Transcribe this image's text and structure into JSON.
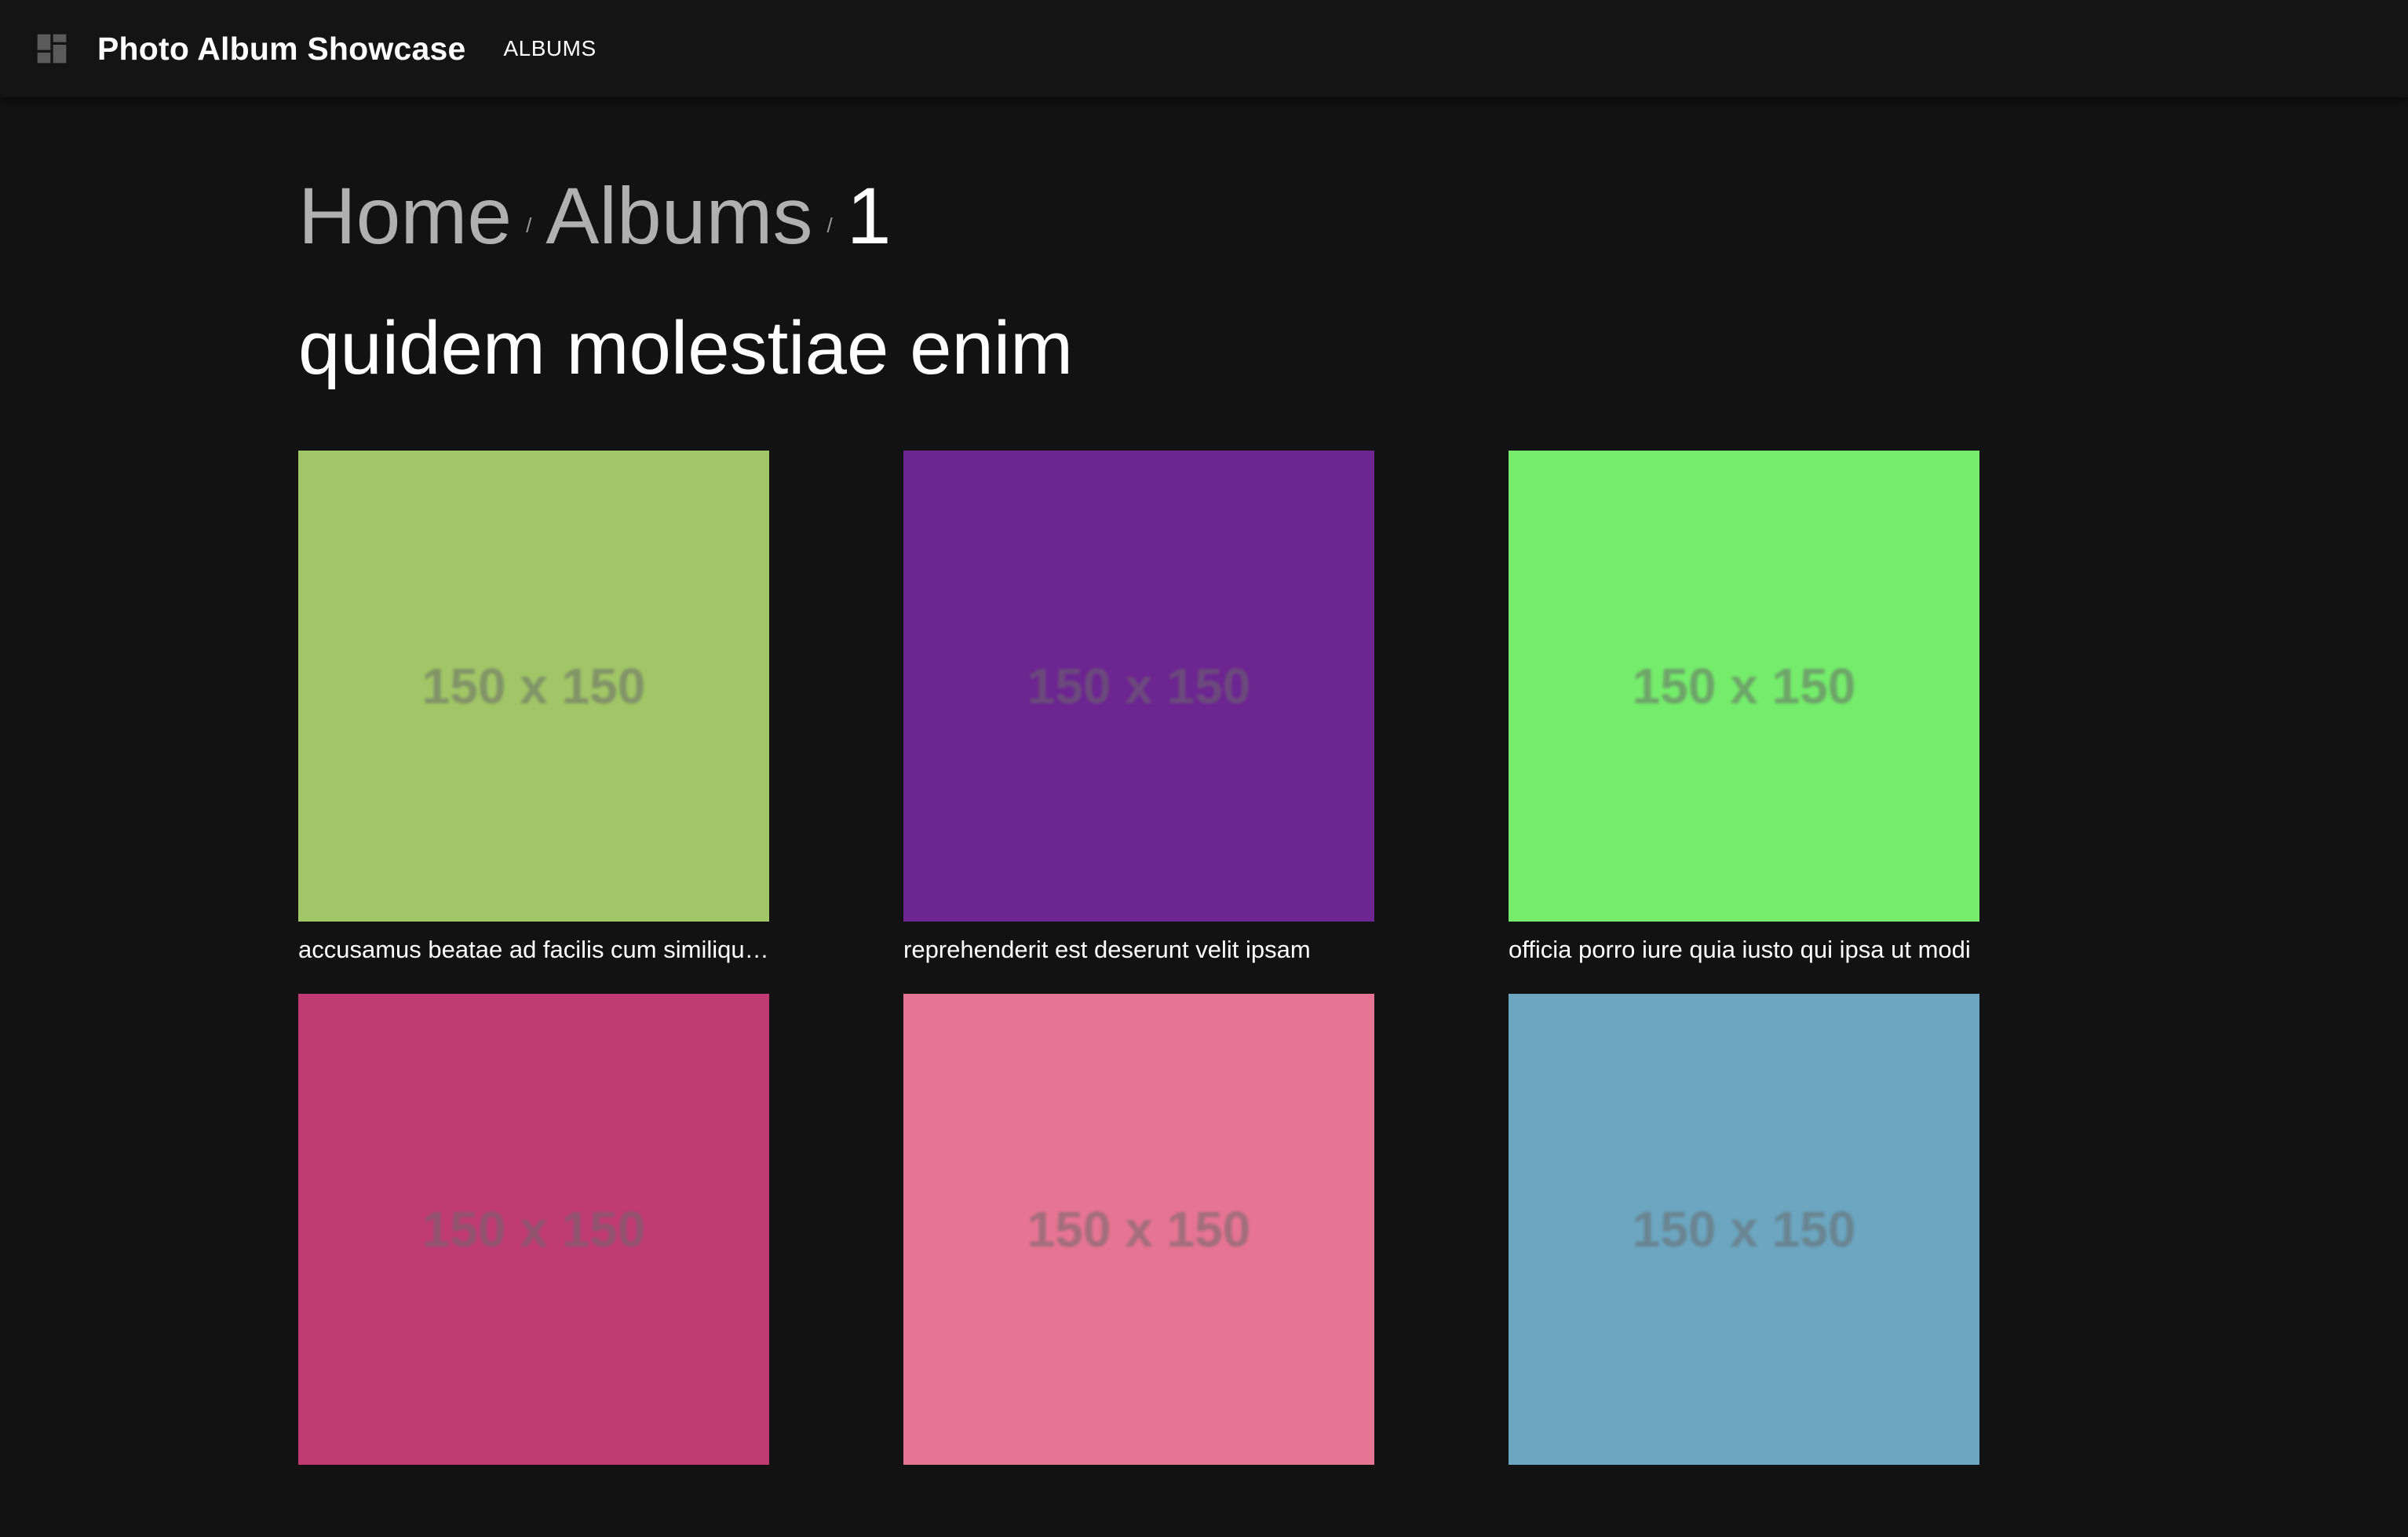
{
  "appbar": {
    "logo_icon": "dashboard-icon",
    "title": "Photo Album Showcase",
    "nav_albums": "ALBUMS"
  },
  "breadcrumb": {
    "home": "Home",
    "separator": "/",
    "albums": "Albums",
    "current": "1"
  },
  "album": {
    "title": "quidem molestiae enim"
  },
  "photos": [
    {
      "placeholder": "150 x 150",
      "color": "#a0c667",
      "caption": "accusamus beatae ad facilis cum similique qui sunt"
    },
    {
      "placeholder": "150 x 150",
      "color": "#6d2591",
      "caption": "reprehenderit est deserunt velit ipsam"
    },
    {
      "placeholder": "150 x 150",
      "color": "#75ec6c",
      "caption": "officia porro iure quia iusto qui ipsa ut modi"
    },
    {
      "placeholder": "150 x 150",
      "color": "#c03a74",
      "caption": ""
    },
    {
      "placeholder": "150 x 150",
      "color": "#e67494",
      "caption": ""
    },
    {
      "placeholder": "150 x 150",
      "color": "#6ca6c0",
      "caption": ""
    }
  ],
  "colors": {
    "background": "#121212",
    "appbar": "#141414",
    "breadcrumb_link": "#b0b0b0"
  }
}
